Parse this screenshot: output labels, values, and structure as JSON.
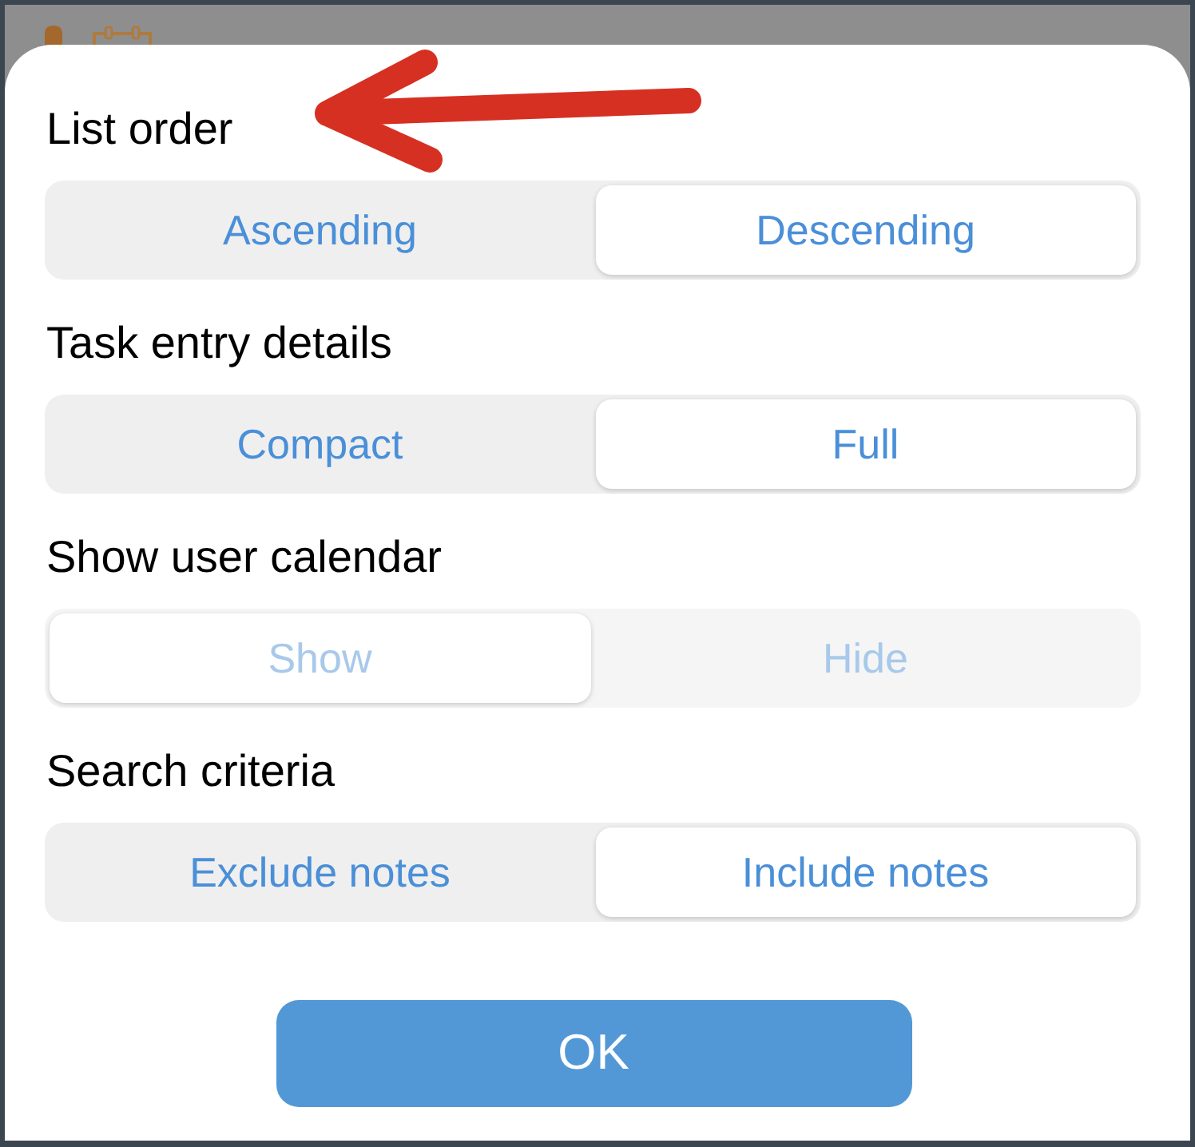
{
  "settings": [
    {
      "label": "List order",
      "disabled": false,
      "options": [
        {
          "label": "Ascending",
          "selected": false
        },
        {
          "label": "Descending",
          "selected": true
        }
      ]
    },
    {
      "label": "Task entry details",
      "disabled": false,
      "options": [
        {
          "label": "Compact",
          "selected": false
        },
        {
          "label": "Full",
          "selected": true
        }
      ]
    },
    {
      "label": "Show user calendar",
      "disabled": true,
      "options": [
        {
          "label": "Show",
          "selected": true
        },
        {
          "label": "Hide",
          "selected": false
        }
      ]
    },
    {
      "label": "Search criteria",
      "disabled": false,
      "options": [
        {
          "label": "Exclude notes",
          "selected": false
        },
        {
          "label": "Include notes",
          "selected": true
        }
      ]
    }
  ],
  "ok_button": {
    "label": "OK"
  }
}
